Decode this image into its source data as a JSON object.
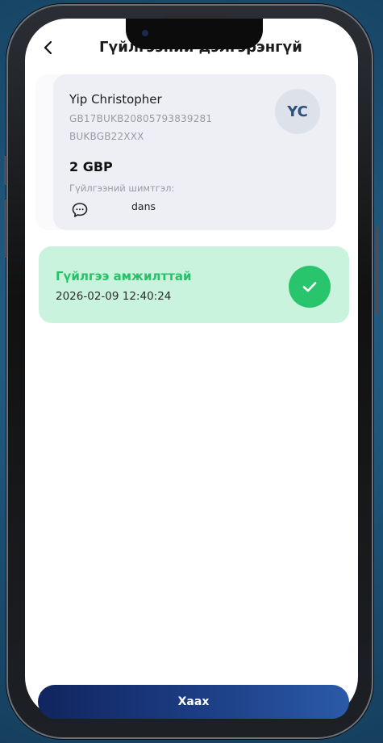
{
  "header": {
    "title": "Гүйлгээний дэлгэрэнгүй"
  },
  "recipient": {
    "name": "Yip Christopher",
    "iban": "GB17BUKB20805793839281",
    "bic": "BUKBGB22XXX",
    "initials": "YC"
  },
  "transaction": {
    "amount": "2 GBP",
    "fee_label": "Гүйлгээний шимтгэл:",
    "note": "dans"
  },
  "status": {
    "title": "Гүйлгээ амжилттай",
    "datetime": "2026-02-09 12:40:24"
  },
  "footer": {
    "close_label": "Хаах"
  },
  "colors": {
    "success_bg": "#c9f3dc",
    "success_text": "#25c26a",
    "accent": "#1d3f86"
  }
}
